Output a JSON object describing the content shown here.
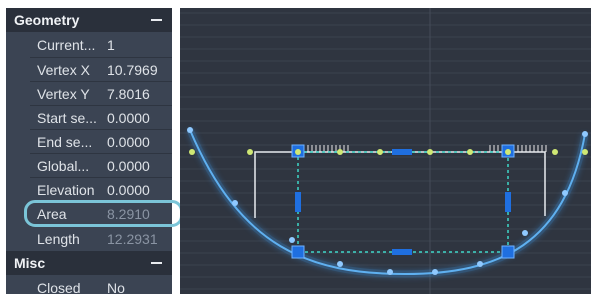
{
  "palette": {
    "geometry": {
      "title": "Geometry",
      "rows": [
        {
          "label": "Current...",
          "value": "1"
        },
        {
          "label": "Vertex X",
          "value": "10.7969"
        },
        {
          "label": "Vertex Y",
          "value": "7.8016"
        },
        {
          "label": "Start se...",
          "value": "0.0000"
        },
        {
          "label": "End se...",
          "value": "0.0000"
        },
        {
          "label": "Global...",
          "value": "0.0000"
        },
        {
          "label": "Elevation",
          "value": "0.0000"
        },
        {
          "label": "Area",
          "value": "8.2910"
        },
        {
          "label": "Length",
          "value": "12.2931"
        }
      ]
    },
    "misc": {
      "title": "Misc",
      "rows": [
        {
          "label": "Closed",
          "value": "No"
        }
      ]
    }
  },
  "colors": {
    "palette_bg": "#3b4453",
    "header_bg": "#2a303b",
    "canvas_bg": "#2f3540",
    "highlight": "#7bc5d8",
    "selected_curve": "#3a8fd8",
    "green_line": "#b6dc4a",
    "grip": "#1f6fe0",
    "dashed": "#3fd6c8"
  },
  "icons": {
    "section_toggle": "collapse-minus-icon"
  }
}
